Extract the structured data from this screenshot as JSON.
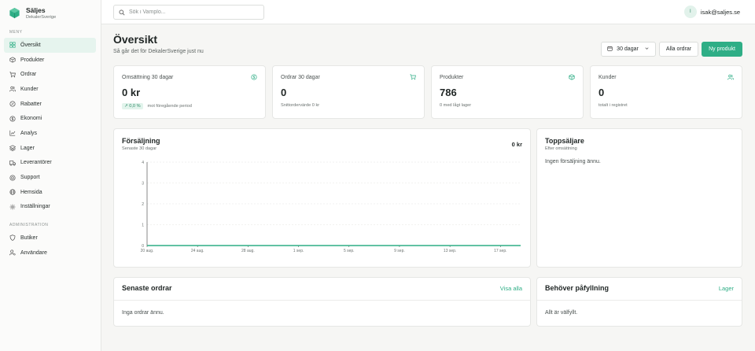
{
  "brand": {
    "name": "Säljes",
    "subtitle": "DekalerSverige"
  },
  "sidebar": {
    "menu_label": "MENY",
    "items": [
      {
        "label": "Översikt",
        "icon": "grid-icon"
      },
      {
        "label": "Produkter",
        "icon": "box-icon"
      },
      {
        "label": "Ordrar",
        "icon": "cart-icon"
      },
      {
        "label": "Kunder",
        "icon": "users-icon"
      },
      {
        "label": "Rabatter",
        "icon": "tag-icon"
      },
      {
        "label": "Ekonomi",
        "icon": "dollar-icon"
      },
      {
        "label": "Analys",
        "icon": "chart-icon"
      },
      {
        "label": "Lager",
        "icon": "layers-icon"
      },
      {
        "label": "Leverantörer",
        "icon": "truck-icon"
      },
      {
        "label": "Support",
        "icon": "help-icon"
      },
      {
        "label": "Hemsida",
        "icon": "globe-icon"
      },
      {
        "label": "Inställningar",
        "icon": "gear-icon"
      }
    ],
    "admin_label": "ADMINISTRATION",
    "admin_items": [
      {
        "label": "Butiker",
        "icon": "shield-icon"
      },
      {
        "label": "Användare",
        "icon": "user-gear-icon"
      }
    ]
  },
  "topbar": {
    "search_placeholder": "Sök i Vamplo...",
    "user_initial": "I",
    "user_email": "isak@saljes.se"
  },
  "header": {
    "title": "Översikt",
    "subtitle": "Så går det för DekalerSverige just nu",
    "period_label": "30 dagar",
    "orders_button": "Alla ordrar",
    "new_product_button": "Ny produkt"
  },
  "stats": [
    {
      "title": "Omsättning 30 dagar",
      "value": "0 kr",
      "badge": "↗ 0,0 %",
      "foot": "mot föregående period",
      "icon": "dollar-icon"
    },
    {
      "title": "Ordrar 30 dagar",
      "value": "0",
      "foot": "Snittordervärde 0 kr",
      "icon": "cart-icon"
    },
    {
      "title": "Produkter",
      "value": "786",
      "foot": "0 med lågt lager",
      "icon": "box-icon"
    },
    {
      "title": "Kunder",
      "value": "0",
      "foot": "totalt i registret",
      "icon": "users-icon"
    }
  ],
  "sales_card": {
    "title": "Försäljning",
    "subtitle": "Senaste 30 dagar",
    "total": "0 kr"
  },
  "top_sellers": {
    "title": "Toppsäljare",
    "subtitle": "Efter omsättning",
    "empty": "Ingen försäljning ännu."
  },
  "recent_orders": {
    "title": "Senaste ordrar",
    "link": "Visa alla",
    "empty": "Inga ordrar ännu."
  },
  "restock": {
    "title": "Behöver påfyllning",
    "link": "Lager",
    "empty": "Allt är välfyllt."
  },
  "colors": {
    "accent": "#2fae86",
    "active_bg": "#e6f4ee",
    "line": "#2fae86"
  },
  "chart_data": {
    "type": "line",
    "x_ticks": [
      "20 aug.",
      "24 aug.",
      "28 aug.",
      "1 sep.",
      "5 sep.",
      "9 sep.",
      "13 sep.",
      "17 sep."
    ],
    "y_ticks": [
      "0",
      "1",
      "2",
      "3",
      "4"
    ],
    "ylim": [
      0,
      4
    ],
    "series": [
      {
        "values": [
          0,
          0,
          0,
          0,
          0,
          0,
          0,
          0,
          0,
          0,
          0,
          0,
          0,
          0,
          0,
          0,
          0,
          0,
          0,
          0,
          0,
          0,
          0,
          0,
          0,
          0,
          0,
          0,
          0,
          0,
          0
        ]
      }
    ],
    "grid": true
  }
}
